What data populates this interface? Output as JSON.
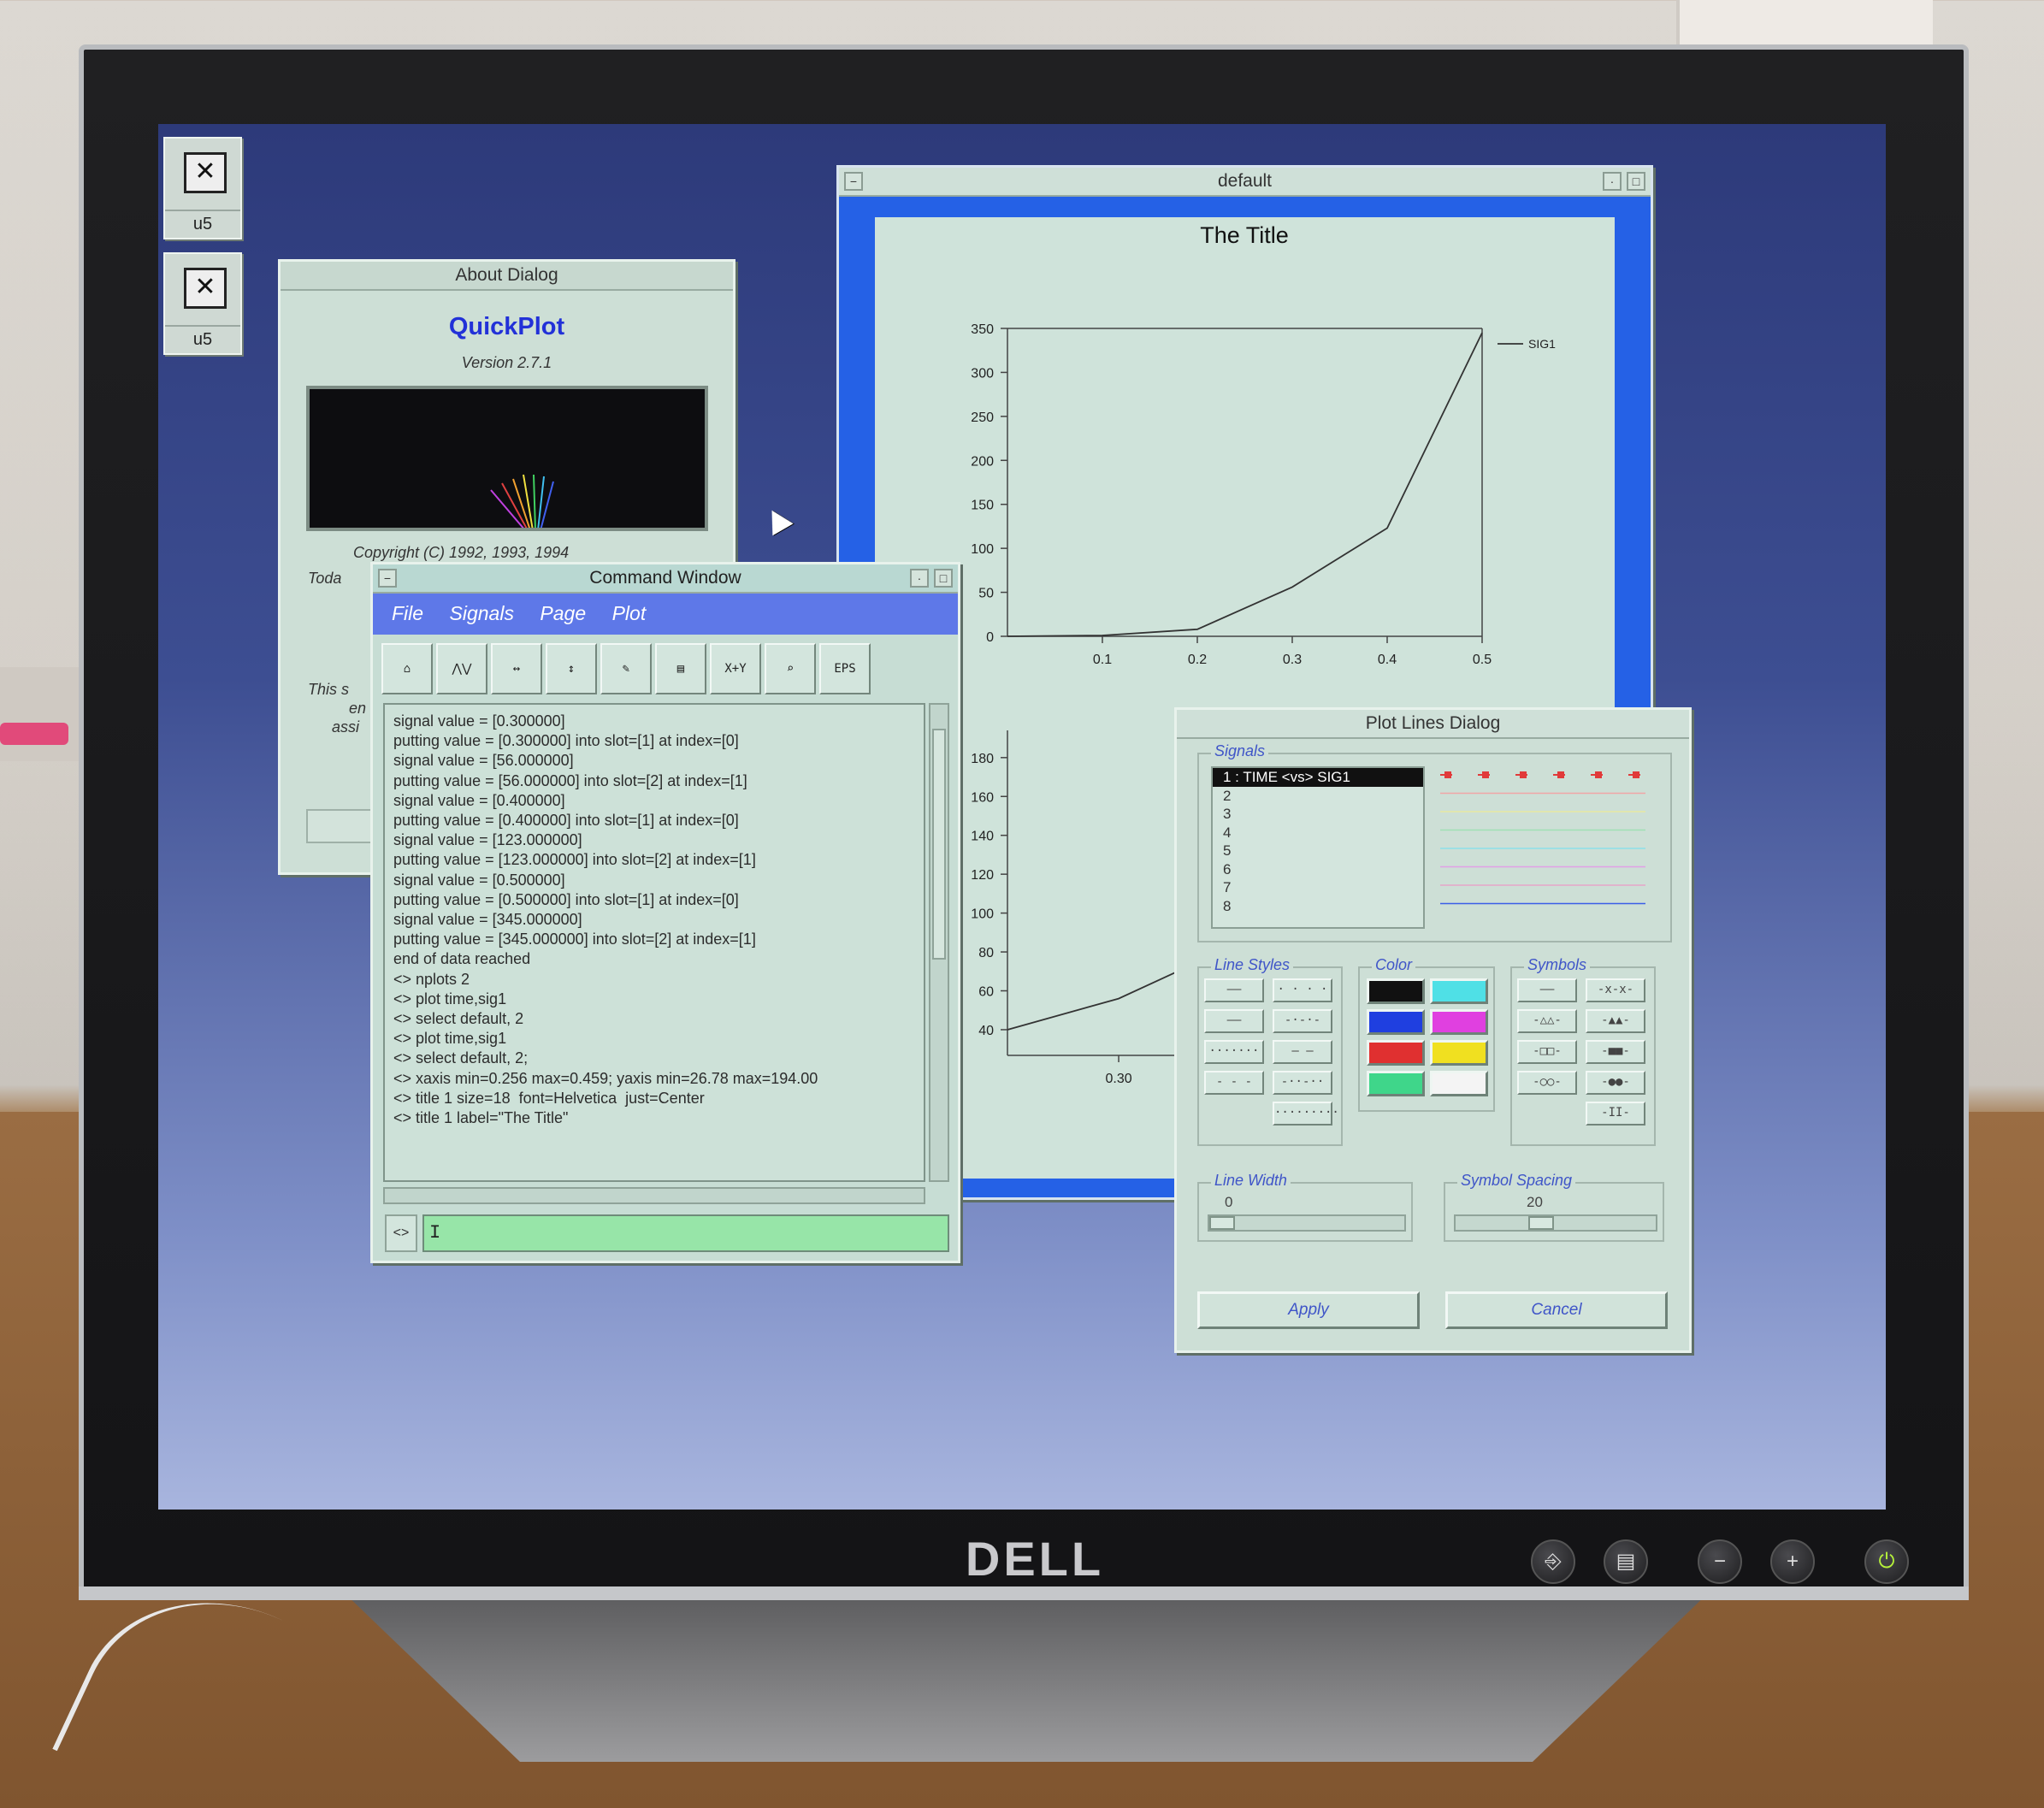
{
  "monitor": {
    "brand": "DELL",
    "buttons": [
      "input-icon",
      "menu-icon",
      "minus-icon",
      "plus-icon",
      "power-icon"
    ],
    "button_glyphs": [
      "⎆",
      "▤",
      "−",
      "+",
      "⏻"
    ]
  },
  "desktop": {
    "icons": [
      {
        "label": "u5",
        "icon": "computer-icon"
      },
      {
        "label": "u5",
        "icon": "computer-icon"
      }
    ]
  },
  "about_dialog": {
    "title": "About Dialog",
    "brand": "QuickPlot",
    "version": "Version 2.7.1",
    "copyright": "Copyright (C) 1992, 1993, 1994",
    "side_text": [
      "Toda",
      "This s",
      "en",
      "assi"
    ]
  },
  "command_window": {
    "title": "Command Window",
    "menu": [
      "File",
      "Signals",
      "Page",
      "Plot"
    ],
    "tools": [
      {
        "icon": "open-folder-icon",
        "glyph": "⌂"
      },
      {
        "icon": "signal-plot-icon",
        "glyph": "⋀⋁"
      },
      {
        "icon": "x-axis-icon",
        "glyph": "↔"
      },
      {
        "icon": "y-axis-icon",
        "glyph": "↕"
      },
      {
        "icon": "pen-icon",
        "glyph": "✎"
      },
      {
        "icon": "page-icon",
        "glyph": "▤"
      },
      {
        "icon": "xy-cursor-icon",
        "glyph": "X+Y"
      },
      {
        "icon": "zoom-icon",
        "glyph": "⌕"
      },
      {
        "icon": "eps-export-icon",
        "glyph": "EPS"
      }
    ],
    "log": [
      "signal value = [0.300000]",
      "putting value = [0.300000] into slot=[1] at index=[0]",
      "signal value = [56.000000]",
      "putting value = [56.000000] into slot=[2] at index=[1]",
      "signal value = [0.400000]",
      "putting value = [0.400000] into slot=[1] at index=[0]",
      "signal value = [123.000000]",
      "putting value = [123.000000] into slot=[2] at index=[1]",
      "signal value = [0.500000]",
      "putting value = [0.500000] into slot=[1] at index=[0]",
      "signal value = [345.000000]",
      "putting value = [345.000000] into slot=[2] at index=[1]",
      "end of data reached",
      "<> nplots 2",
      "<> plot time,sig1",
      "<> select default, 2",
      "<> plot time,sig1",
      "<> select default, 2;",
      "<> xaxis min=0.256 max=0.459; yaxis min=26.78 max=194.00",
      "<> title 1 size=18  font=Helvetica  just=Center",
      "<> title 1 label=\"The Title\""
    ],
    "prompt_label": "<>",
    "input_value": "I"
  },
  "plot_window": {
    "title": "default",
    "plot_title": "The Title"
  },
  "chart_data": [
    {
      "type": "line",
      "title": "The Title",
      "xlabel": "",
      "ylabel": "",
      "legend_position": "top-right",
      "grid": false,
      "xlim": [
        0,
        0.5
      ],
      "ylim": [
        0,
        350
      ],
      "x_ticks": [
        "0.1",
        "0.2",
        "0.3",
        "0.4",
        "0.5"
      ],
      "y_ticks": [
        "0",
        "50",
        "100",
        "150",
        "200",
        "250",
        "300",
        "350"
      ],
      "series": [
        {
          "name": "SIG1",
          "x": [
            0,
            0.1,
            0.2,
            0.3,
            0.4,
            0.5
          ],
          "y": [
            0,
            1,
            8,
            56,
            123,
            345
          ]
        }
      ]
    },
    {
      "type": "line",
      "title": "",
      "xlabel": "",
      "ylabel": "",
      "grid": false,
      "xlim": [
        0.256,
        0.459
      ],
      "ylim": [
        26.78,
        194.0
      ],
      "x_ticks": [
        "0.30"
      ],
      "y_ticks": [
        "40",
        "60",
        "80",
        "100",
        "120",
        "140",
        "160",
        "180"
      ],
      "series": [
        {
          "x": [
            0.256,
            0.3,
            0.34
          ],
          "y": [
            40,
            56,
            80
          ]
        }
      ]
    }
  ],
  "plot_lines_dialog": {
    "title": "Plot Lines Dialog",
    "signals_label": "Signals",
    "signals": [
      "1 : TIME <vs> SIG1",
      "2",
      "3",
      "4",
      "5",
      "6",
      "7",
      "8"
    ],
    "preview_colors": [
      "#e13a3a",
      "#f0a6a6",
      "#e8e8a0",
      "#9fe0b4",
      "#8de0e8",
      "#e2a0e6",
      "#e6a6c8",
      "#3a5ee8"
    ],
    "line_styles_label": "Line Styles",
    "line_styles": [
      "——",
      "· · · ·",
      "——",
      "-·-·-",
      "·······",
      "— —",
      "- - -",
      "-··-··",
      "·········"
    ],
    "color_label": "Color",
    "colors": [
      "#111111",
      "#4fe0e6",
      "#1f3fe0",
      "#e040e0",
      "#e03030",
      "#f0e020",
      "#3fd68a",
      "#f4f4f4"
    ],
    "symbols_label": "Symbols",
    "symbols": [
      "——",
      "-x-x-",
      "-△△-",
      "-▲▲-",
      "-□□-",
      "-■■-",
      "-○○-",
      "-●●-",
      "-II-"
    ],
    "line_width_label": "Line Width",
    "line_width_value": "0",
    "symbol_spacing_label": "Symbol Spacing",
    "symbol_spacing_value": "20",
    "apply_label": "Apply",
    "cancel_label": "Cancel"
  }
}
